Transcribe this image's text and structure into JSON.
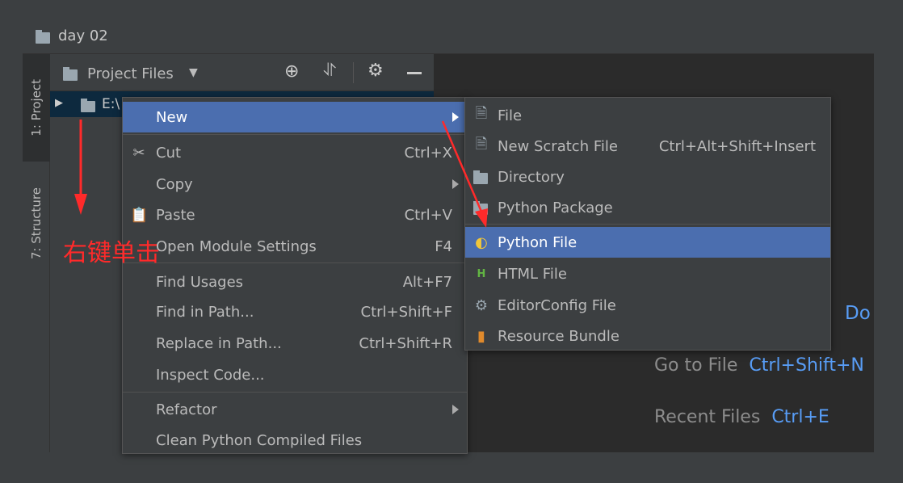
{
  "window": {
    "title": "day 02"
  },
  "toolstrip": {
    "project_tab": "1: Project",
    "structure_tab": "7: Structure"
  },
  "panel": {
    "title": "Project Files",
    "tree_root": "E:\\"
  },
  "context_menu": [
    {
      "label": "New",
      "shortcut": "",
      "submenu": true,
      "highlighted": true
    },
    {
      "label": "Cut",
      "shortcut": "Ctrl+X",
      "icon": "scissors-icon"
    },
    {
      "label": "Copy",
      "shortcut": "",
      "submenu": true
    },
    {
      "label": "Paste",
      "shortcut": "Ctrl+V",
      "icon": "clipboard-icon"
    },
    {
      "label": "Open Module Settings",
      "shortcut": "F4"
    },
    {
      "label": "Find Usages",
      "shortcut": "Alt+F7"
    },
    {
      "label": "Find in Path...",
      "shortcut": "Ctrl+Shift+F"
    },
    {
      "label": "Replace in Path...",
      "shortcut": "Ctrl+Shift+R"
    },
    {
      "label": "Inspect Code...",
      "shortcut": ""
    },
    {
      "label": "Refactor",
      "shortcut": "",
      "submenu": true
    },
    {
      "label": "Clean Python Compiled Files",
      "shortcut": ""
    }
  ],
  "new_submenu": [
    {
      "label": "File",
      "shortcut": "",
      "icon": "file-icon"
    },
    {
      "label": "New Scratch File",
      "shortcut": "Ctrl+Alt+Shift+Insert",
      "icon": "scratch-file-icon"
    },
    {
      "label": "Directory",
      "shortcut": "",
      "icon": "folder-icon"
    },
    {
      "label": "Python Package",
      "shortcut": "",
      "icon": "package-icon"
    },
    {
      "label": "Python File",
      "shortcut": "",
      "icon": "python-file-icon",
      "highlighted": true
    },
    {
      "label": "HTML File",
      "shortcut": "",
      "icon": "html-file-icon"
    },
    {
      "label": "EditorConfig File",
      "shortcut": "",
      "icon": "gear-icon"
    },
    {
      "label": "Resource Bundle",
      "shortcut": "",
      "icon": "resource-bundle-icon"
    }
  ],
  "editor_hints": {
    "partial": "Do",
    "goto_label": "Go to File",
    "goto_key": "Ctrl+Shift+N",
    "recent_label": "Recent Files",
    "recent_key": "Ctrl+E"
  },
  "annotation": {
    "text": "右键单击",
    "color": "#ff2a2a"
  },
  "colors": {
    "highlight": "#4b6eaf",
    "selection": "#0d293e",
    "link": "#589df6"
  }
}
